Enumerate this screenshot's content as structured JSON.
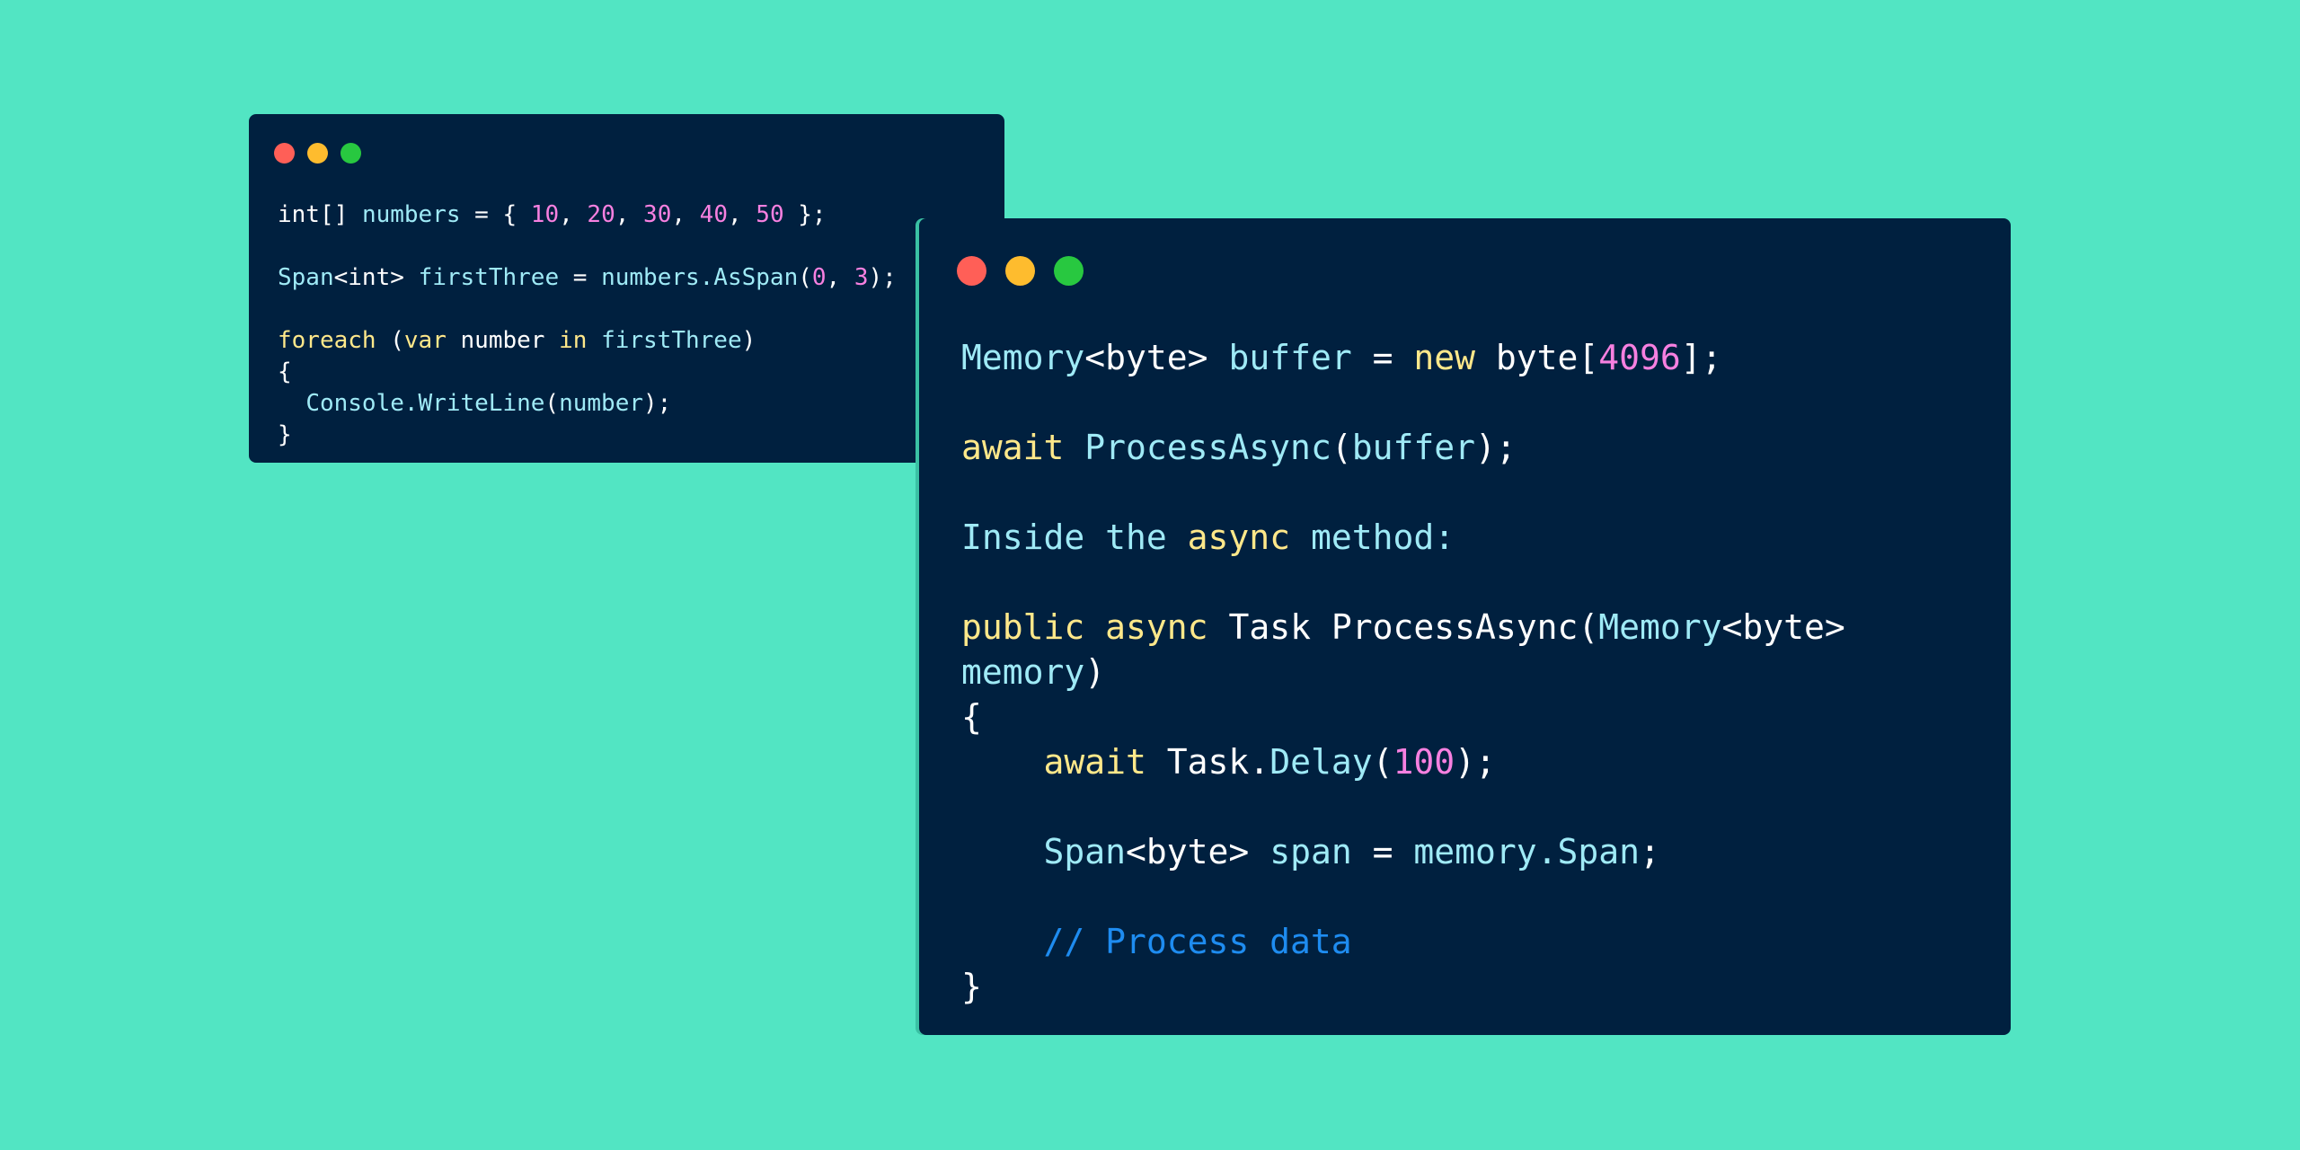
{
  "colors": {
    "background": "#52e5c3",
    "window_bg": "#00203f",
    "keyword": "#ffe88a",
    "identifier": "#9feaf6",
    "number": "#f780e0",
    "plain": "#ffffff",
    "comment": "#1e8cf0",
    "traffic_red": "#ff5f57",
    "traffic_yellow": "#febc2e",
    "traffic_green": "#28c840"
  },
  "window_small": {
    "line1": [
      "int[]",
      " ",
      "numbers",
      " = { ",
      "10",
      ", ",
      "20",
      ", ",
      "30",
      ", ",
      "40",
      ", ",
      "50",
      " };"
    ],
    "line2": [
      "Span",
      "<int>",
      " ",
      "firstThree",
      " = ",
      "numbers.AsSpan",
      "(",
      "0",
      ", ",
      "3",
      ");"
    ],
    "line3": [
      "foreach",
      " (",
      "var",
      " number ",
      "in",
      " ",
      "firstThree",
      ")"
    ],
    "line4": "{",
    "line5": [
      "  ",
      "Console.WriteLine",
      "(",
      "number",
      ");"
    ],
    "line6": "}"
  },
  "window_large": {
    "line1": [
      "Memory",
      "<byte>",
      " ",
      "buffer",
      " = ",
      "new",
      " byte[",
      "4096",
      "];"
    ],
    "line2": [
      "await",
      " ",
      "ProcessAsync",
      "(",
      "buffer",
      ");"
    ],
    "line3": [
      "Inside the ",
      "async",
      " method:"
    ],
    "line4": [
      "public",
      " ",
      "async",
      " Task ProcessAsync(",
      "Memory",
      "<byte>"
    ],
    "line5": [
      "memory",
      ")"
    ],
    "line6": "{",
    "line7": [
      "    ",
      "await",
      " Task.",
      "Delay",
      "(",
      "100",
      ");"
    ],
    "line8": [
      "    ",
      "Span",
      "<byte>",
      " ",
      "span",
      " = ",
      "memory.Span",
      ";"
    ],
    "line9": "    // Process data",
    "line10": "}"
  }
}
